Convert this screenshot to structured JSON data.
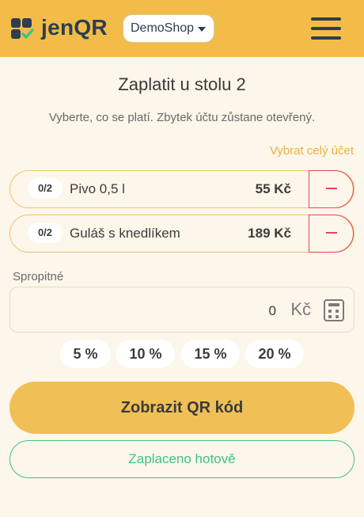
{
  "brand": {
    "name": "jenQR",
    "logo_icon": "jenqr-logo-icon"
  },
  "navbar": {
    "shop": "DemoShop",
    "menu_icon": "hamburger-menu-icon",
    "color": "#f3bc48"
  },
  "page": {
    "title": "Zaplatit u stolu 2",
    "subtitle": "Vyberte, co se platí. Zbytek účtu zůstane otevřený.",
    "select_all": "Vybrat celý účet"
  },
  "items": [
    {
      "qty": "0/2",
      "name": "Pivo 0,5 l",
      "price": "55 Kč"
    },
    {
      "qty": "0/2",
      "name": "Guláš s knedlíkem",
      "price": "189 Kč"
    }
  ],
  "tip": {
    "label": "Spropitné",
    "value": "0",
    "currency": "Kč",
    "calc_icon": "calculator-icon",
    "presets": [
      "5 %",
      "10 %",
      "15 %",
      "20 %"
    ]
  },
  "actions": {
    "show_qr": "Zobrazit QR kód",
    "paid_cash": "Zaplaceno hotově"
  },
  "colors": {
    "accent": "#f0c057",
    "danger": "#e0475a",
    "success": "#3ec28a",
    "background": "#fdf6ea"
  }
}
